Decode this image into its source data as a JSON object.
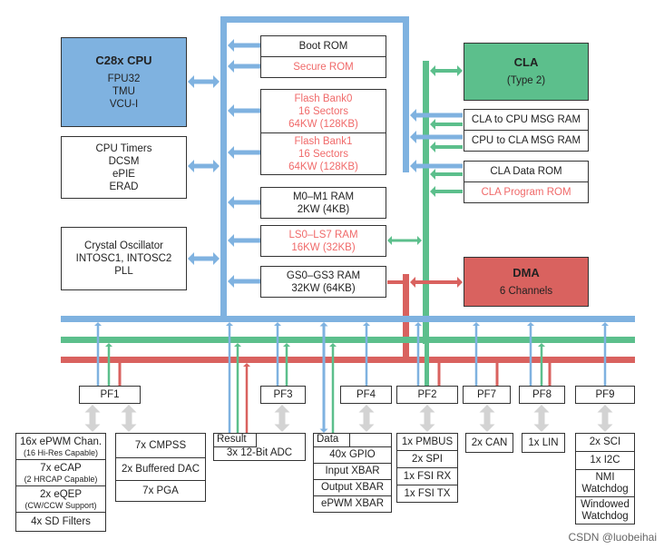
{
  "colors": {
    "blue_bus": "#7fb2e0",
    "green_bus": "#5cbf8c",
    "red_bus": "#d9625f",
    "peripheral_arrow": "#d3d3d3",
    "secure_text": "#f06a6a"
  },
  "cpu": {
    "title": "C28x CPU",
    "lines": [
      "FPU32",
      "TMU",
      "VCU-I"
    ]
  },
  "timers": {
    "lines": [
      "CPU Timers",
      "DCSM",
      "ePIE",
      "ERAD"
    ]
  },
  "osc": {
    "lines": [
      "Crystal Oscillator",
      "INTOSC1, INTOSC2",
      "PLL"
    ]
  },
  "memory": {
    "boot_rom": "Boot ROM",
    "secure_rom": "Secure ROM",
    "flash0": [
      "Flash Bank0",
      "16 Sectors",
      "64KW (128KB)"
    ],
    "flash1": [
      "Flash Bank1",
      "16 Sectors",
      "64KW (128KB)"
    ],
    "m0m1": [
      "M0–M1 RAM",
      "2KW (4KB)"
    ],
    "ls": [
      "LS0–LS7 RAM",
      "16KW (32KB)"
    ],
    "gs": [
      "GS0–GS3 RAM",
      "32KW (64KB)"
    ]
  },
  "cla": {
    "title": "CLA",
    "subtitle": "(Type 2)",
    "cla_to_cpu": "CLA to CPU MSG RAM",
    "cpu_to_cla": "CPU to CLA MSG RAM",
    "data_rom": "CLA Data ROM",
    "program_rom": "CLA Program ROM"
  },
  "dma": {
    "title": "DMA",
    "subtitle": "6 Channels"
  },
  "pf": {
    "pf1": "PF1",
    "pf3": "PF3",
    "pf4": "PF4",
    "pf2": "PF2",
    "pf7": "PF7",
    "pf8": "PF8",
    "pf9": "PF9"
  },
  "peripherals": {
    "pf1a": [
      [
        "16x ePWM Chan.",
        "(16 Hi-Res Capable)"
      ],
      [
        "7x eCAP",
        "(2 HRCAP Capable)"
      ],
      [
        "2x eQEP",
        "(CW/CCW Support)"
      ],
      [
        "4x SD Filters"
      ]
    ],
    "pf1b": [
      "7x CMPSS",
      "2x Buffered DAC",
      "7x PGA"
    ],
    "adc": {
      "tab": "Result",
      "label": "3x 12-Bit ADC"
    },
    "gpio": {
      "tab": "Data",
      "items": [
        "40x GPIO",
        "Input XBAR",
        "Output XBAR",
        "ePWM XBAR"
      ]
    },
    "pf2": [
      "1x PMBUS",
      "2x SPI",
      "1x FSI RX",
      "1x FSI TX"
    ],
    "pf7": "2x CAN",
    "pf8": "1x LIN",
    "pf9": [
      "2x SCI",
      "1x I2C",
      "NMI Watchdog",
      "Windowed Watchdog"
    ]
  },
  "watermark": "CSDN @luobeihai"
}
